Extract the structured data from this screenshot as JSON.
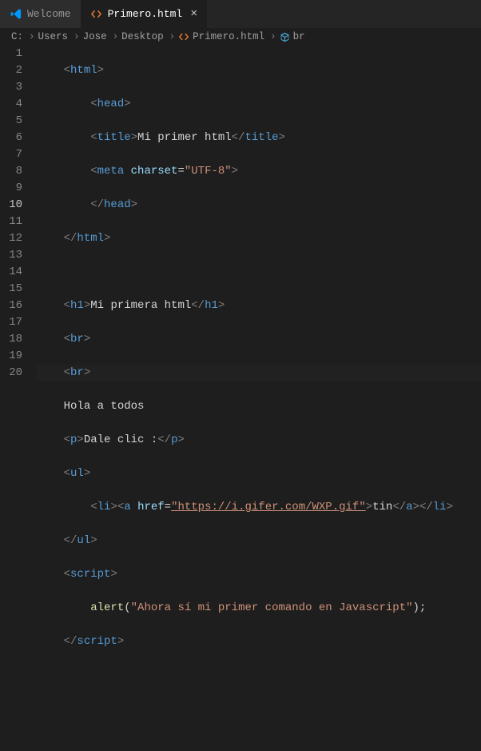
{
  "tabs": {
    "welcome": {
      "label": "Welcome"
    },
    "primero": {
      "label": "Primero.html"
    }
  },
  "breadcrumbs": {
    "c": "C:",
    "users": "Users",
    "jose": "Jose",
    "desktop": "Desktop",
    "file": "Primero.html",
    "symbol": "br"
  },
  "lines": {
    "n1": "1",
    "n2": "2",
    "n3": "3",
    "n4": "4",
    "n5": "5",
    "n6": "6",
    "n7": "7",
    "n8": "8",
    "n9": "9",
    "n10": "10",
    "n11": "11",
    "n12": "12",
    "n13": "13",
    "n14": "14",
    "n15": "15",
    "n16": "16",
    "n17": "17",
    "n18": "18",
    "n19": "19",
    "n20": "20"
  },
  "code": {
    "ind1": "    ",
    "ind2": "        ",
    "html_open_tag": "html",
    "head_open_tag": "head",
    "title_tag": "title",
    "title_text": "Mi primer html",
    "meta_tag": "meta",
    "meta_attr": "charset",
    "meta_eq": "=",
    "meta_val": "\"UTF-8\"",
    "head_close": "head",
    "html_close": "html",
    "h1_tag": "h1",
    "h1_text": "Mi primera html",
    "br_tag": "br",
    "hola": "Hola a todos",
    "p_tag": "p",
    "p_text": "Dale clic :",
    "ul_tag": "ul",
    "li_tag": "li",
    "a_tag": "a",
    "a_attr": "href",
    "a_eq": "=",
    "a_url": "\"https://i.gifer.com/WXP.gif\"",
    "a_text": "tin",
    "script_tag": "script",
    "alert_fn": "alert",
    "alert_paren_o": "(",
    "alert_str": "\"Ahora sí mi primer comando en Javascript\"",
    "alert_paren_c": ")",
    "alert_semi": ";"
  },
  "colors": {
    "tag_blue": "#569cd6",
    "string_orange": "#ce9178",
    "attr_lightblue": "#9cdcfe",
    "func_yellow": "#dcdcaa",
    "bg": "#1e1e1e"
  }
}
